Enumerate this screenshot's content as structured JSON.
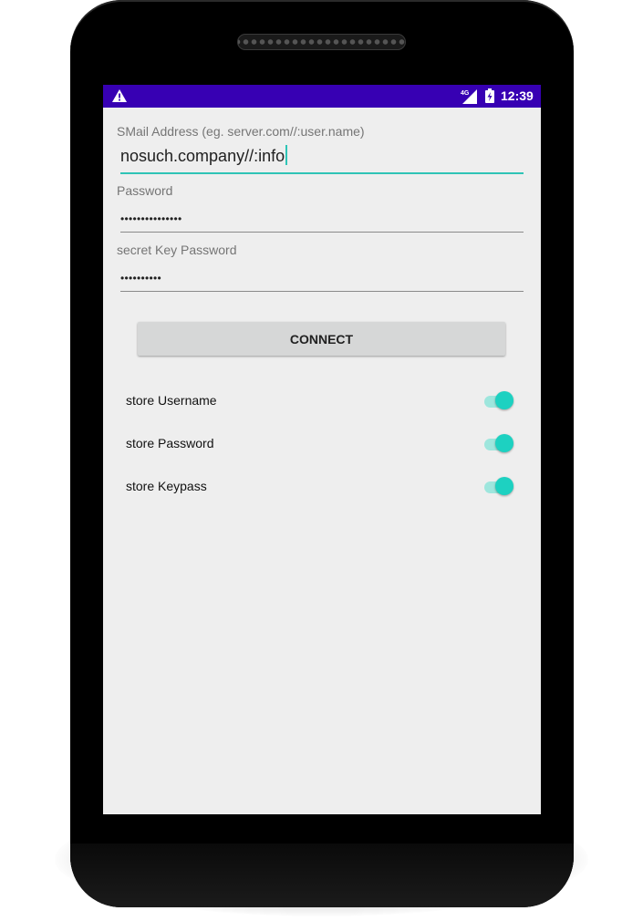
{
  "statusbar": {
    "time": "12:39",
    "network_label": "4G",
    "warning_icon": "warning-icon",
    "signal_icon": "signal-4g-icon",
    "battery_icon": "battery-charging-icon",
    "color": "#3700b3"
  },
  "form": {
    "email_label": "SMail Address (eg. server.com//:user.name)",
    "email_value": "nosuch.company//:info",
    "password_label": "Password",
    "password_value": "•••••••••••••••",
    "keypass_label": "secret Key Password",
    "keypass_value": "••••••••••"
  },
  "connect_button": {
    "label": "CONNECT"
  },
  "switches": [
    {
      "label": "store Username",
      "on": true
    },
    {
      "label": "store Password",
      "on": true
    },
    {
      "label": "store Keypass",
      "on": true
    }
  ],
  "colors": {
    "accent": "#2ec4b6",
    "screen_bg": "#eeeeee"
  }
}
